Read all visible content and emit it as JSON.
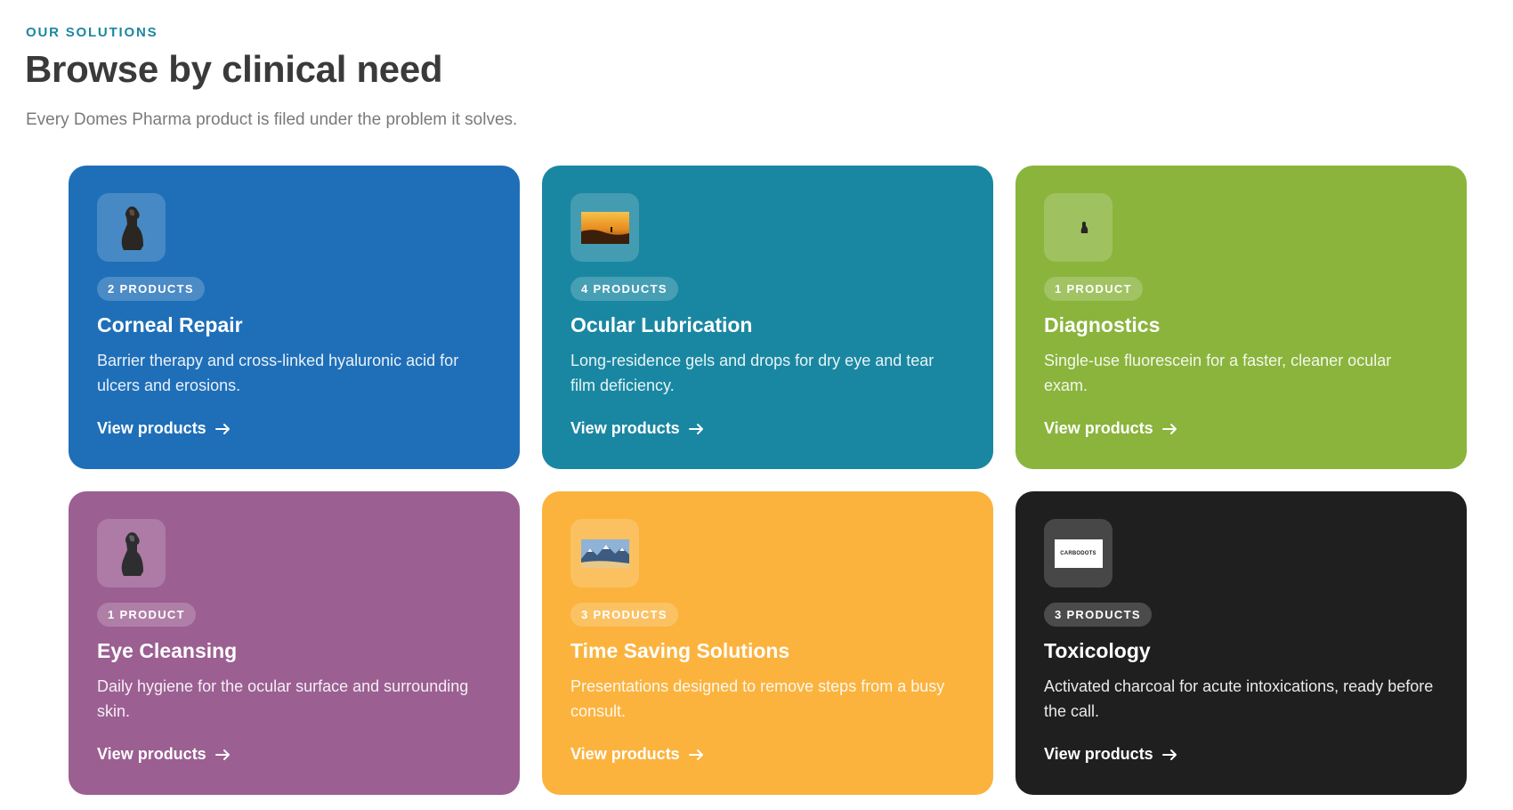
{
  "header": {
    "eyebrow": "OUR SOLUTIONS",
    "title": "Browse by clinical need",
    "subtitle": "Every Domes Pharma product is filed under the problem it solves."
  },
  "cards": [
    {
      "badge": "2 PRODUCTS",
      "title": "Corneal Repair",
      "description": "Barrier therapy and cross-linked hyaluronic acid for ulcers and erosions.",
      "link": "View products",
      "color": "#1f6fb8",
      "thumb": "dog-thumbnail"
    },
    {
      "badge": "4 PRODUCTS",
      "title": "Ocular Lubrication",
      "description": "Long-residence gels and drops for dry eye and tear film deficiency.",
      "link": "View products",
      "color": "#1a87a2",
      "thumb": "sunset-landscape-thumbnail"
    },
    {
      "badge": "1 PRODUCT",
      "title": "Diagnostics",
      "description": "Single-use fluorescein for a faster, cleaner ocular exam.",
      "link": "View products",
      "color": "#8ab43c",
      "thumb": "small-dog-thumbnail"
    },
    {
      "badge": "1 PRODUCT",
      "title": "Eye Cleansing",
      "description": "Daily hygiene for the ocular surface and surrounding skin.",
      "link": "View products",
      "color": "#9b5f92",
      "thumb": "dog-thumbnail"
    },
    {
      "badge": "3 PRODUCTS",
      "title": "Time Saving Solutions",
      "description": "Presentations designed to remove steps from a busy consult.",
      "link": "View products",
      "color": "#fbb33e",
      "thumb": "mountain-thumbnail"
    },
    {
      "badge": "3 PRODUCTS",
      "title": "Toxicology",
      "description": "Activated charcoal for acute intoxications, ready before the call.",
      "link": "View products",
      "color": "#1f1f1f",
      "thumb": "logo-thumbnail",
      "thumb_text": "CARBODOTS"
    }
  ]
}
